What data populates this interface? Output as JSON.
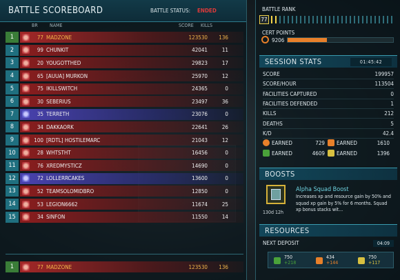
{
  "scoreboard": {
    "title": "BATTLE SCOREBOARD",
    "status_label": "BATTLE STATUS:",
    "status_value": "ENDED",
    "columns": {
      "br": "BR",
      "name": "NAME",
      "score": "SCORE",
      "kills": "KILLS"
    },
    "rows": [
      {
        "rank": "1",
        "br": "77",
        "name": "MADZONE",
        "score": "123530",
        "kills": "136",
        "faction": "r",
        "self": true
      },
      {
        "rank": "2",
        "br": "99",
        "name": "CHUNKIT",
        "score": "42041",
        "kills": "11",
        "faction": "r"
      },
      {
        "rank": "3",
        "br": "20",
        "name": "YOUGOTTHED",
        "score": "29823",
        "kills": "17",
        "faction": "r"
      },
      {
        "rank": "4",
        "br": "65",
        "name": "[AUUA] MURKON",
        "score": "25970",
        "kills": "12",
        "faction": "r"
      },
      {
        "rank": "5",
        "br": "75",
        "name": "IKILLSWITCH",
        "score": "24365",
        "kills": "0",
        "faction": "r"
      },
      {
        "rank": "6",
        "br": "30",
        "name": "SEBERIUS",
        "score": "23497",
        "kills": "36",
        "faction": "r"
      },
      {
        "rank": "7",
        "br": "35",
        "name": "TERRETH",
        "score": "23076",
        "kills": "0",
        "faction": "p"
      },
      {
        "rank": "8",
        "br": "34",
        "name": "DAKKAORK",
        "score": "22641",
        "kills": "26",
        "faction": "r"
      },
      {
        "rank": "9",
        "br": "100",
        "name": "[RDTL] HOSTILEMARC",
        "score": "21043",
        "kills": "12",
        "faction": "r"
      },
      {
        "rank": "10",
        "br": "28",
        "name": "WHTSTHT",
        "score": "16456",
        "kills": "0",
        "faction": "r"
      },
      {
        "rank": "11",
        "br": "76",
        "name": "XREDMYSTICZ",
        "score": "14690",
        "kills": "0",
        "faction": "r"
      },
      {
        "rank": "12",
        "br": "72",
        "name": "LOLLERRCAKES",
        "score": "13600",
        "kills": "0",
        "faction": "p"
      },
      {
        "rank": "13",
        "br": "52",
        "name": "TEAMSOLOMIDBRO",
        "score": "12850",
        "kills": "0",
        "faction": "r"
      },
      {
        "rank": "14",
        "br": "53",
        "name": "LEGION6662",
        "score": "11674",
        "kills": "25",
        "faction": "r"
      },
      {
        "rank": "15",
        "br": "34",
        "name": "SINFON",
        "score": "11550",
        "kills": "14",
        "faction": "r"
      }
    ],
    "self_row": {
      "rank": "1",
      "br": "77",
      "name": "MADZONE",
      "score": "123530",
      "kills": "136"
    }
  },
  "battle_rank": {
    "label": "BATTLE RANK",
    "value": "77",
    "progress": 0.05
  },
  "cert_points": {
    "label": "CERT POINTS",
    "value": "9206",
    "progress": 0.37
  },
  "session": {
    "title": "SESSION STATS",
    "timer": "01:45:42",
    "stats": [
      {
        "label": "SCORE",
        "value": "199957"
      },
      {
        "label": "SCORE/HOUR",
        "value": "113504"
      },
      {
        "label": "FACILITIES CAPTURED",
        "value": "0"
      },
      {
        "label": "FACILITIES DEFENDED",
        "value": "1"
      },
      {
        "label": "KILLS",
        "value": "212"
      },
      {
        "label": "DEATHS",
        "value": "5"
      },
      {
        "label": "K/D",
        "value": "42.4"
      }
    ],
    "earned": [
      {
        "label": "EARNED",
        "value": "729",
        "icon": "cert-icon",
        "color": "#e8802a"
      },
      {
        "label": "EARNED",
        "value": "1610",
        "icon": "resource-orange-icon",
        "color": "#e8802a"
      },
      {
        "label": "EARNED",
        "value": "4609",
        "icon": "resource-green-icon",
        "color": "#4aa23a"
      },
      {
        "label": "EARNED",
        "value": "1396",
        "icon": "resource-yellow-icon",
        "color": "#d8c040"
      }
    ]
  },
  "boosts": {
    "title": "BOOSTS",
    "item": {
      "title": "Alpha Squad Boost",
      "time": "130d 12h",
      "description": "Increases xp and resource gain by 50% and squad xp gain by 5% for 6 months.  Squad xp bonus stacks wit..."
    }
  },
  "resources": {
    "title": "RESOURCES",
    "next_deposit_label": "NEXT DEPOSIT",
    "next_deposit_time": "04:09",
    "items": [
      {
        "value": "750",
        "delta": "+218",
        "color": "#4aa23a",
        "icon": "infantry-resource-icon"
      },
      {
        "value": "434",
        "delta": "+144",
        "color": "#e8802a",
        "icon": "vehicle-resource-icon"
      },
      {
        "value": "750",
        "delta": "+117",
        "color": "#d8c040",
        "icon": "aerospace-resource-icon"
      }
    ]
  }
}
